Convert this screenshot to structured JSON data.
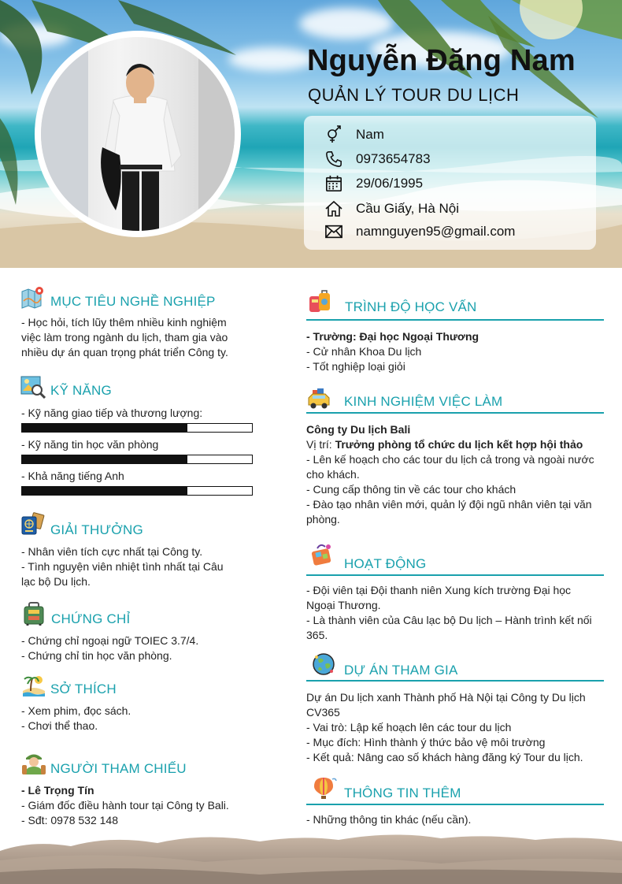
{
  "profile": {
    "name": "Nguyễn Đăng Nam",
    "job_title": "QUẢN LÝ TOUR DU LỊCH",
    "gender": "Nam",
    "phone": "0973654783",
    "birthday": "29/06/1995",
    "address": "Cầu Giấy, Hà Nội",
    "email": "namnguyen95@gmail.com"
  },
  "objective": {
    "title": "MỤC TIÊU NGHỀ NGHIỆP",
    "lines": [
      "- Học hỏi, tích lũy thêm nhiều kinh nghiệm",
      "việc làm trong ngành du lịch, tham gia vào",
      "nhiều dự án quan trọng phát triển Công ty."
    ]
  },
  "skills": {
    "title": "KỸ NĂNG",
    "items": [
      {
        "label": "- Kỹ năng giao tiếp và thương lượng:",
        "level": 0.72
      },
      {
        "label": "- Kỹ năng tin học văn phòng",
        "level": 0.72
      },
      {
        "label": "- Khả năng tiếng Anh",
        "level": 0.72
      }
    ]
  },
  "awards": {
    "title": "GIẢI THƯỞNG",
    "lines": [
      "- Nhân viên tích cực nhất tại Công ty.",
      "- Tình nguyện viên nhiệt tình nhất tại Câu",
      "lạc bộ Du lịch."
    ]
  },
  "certificates": {
    "title": "CHỨNG CHỈ",
    "lines": [
      "- Chứng chỉ ngoại ngữ TOIEC 3.7/4.",
      "- Chứng chỉ tin học văn phòng."
    ]
  },
  "hobbies": {
    "title": "SỞ THÍCH",
    "lines": [
      "- Xem phim, đọc sách.",
      "- Chơi thể thao."
    ]
  },
  "references": {
    "title": "NGƯỜI THAM CHIẾU",
    "name": "- Lê Trọng Tín",
    "lines": [
      "- Giám đốc điều hành tour tại Công ty Bali.",
      "- Sđt: 0978 532 148"
    ]
  },
  "education": {
    "title": "TRÌNH ĐỘ HỌC VẤN",
    "school_label": "- Trường: ",
    "school": "Đại học Ngoại Thương",
    "lines": [
      "- Cử nhân Khoa Du lịch",
      "- Tốt nghiệp loại giỏi"
    ]
  },
  "experience": {
    "title": "KINH NGHIỆM VIỆC LÀM",
    "company": "Công ty Du lịch Bali",
    "position_label": "Vị trí: ",
    "position": "Trưởng phòng tổ chức du lịch kết hợp hội thảo",
    "lines": [
      "- Lên kế hoạch cho các tour du lịch cả trong và ngoài nước",
      "cho khách.",
      "- Cung cấp thông tin về các tour cho khách",
      "- Đào tạo nhân viên mới, quản lý đội ngũ nhân viên tại văn",
      "phòng."
    ]
  },
  "activities": {
    "title": "HOẠT ĐỘNG",
    "lines": [
      "- Đội viên tại Đội thanh niên Xung kích trường Đại học",
      "Ngoại Thương.",
      "- Là thành viên của Câu lạc bộ Du lịch – Hành trình kết nối",
      "365."
    ]
  },
  "projects": {
    "title": "DỰ ÁN THAM GIA",
    "lines": [
      "Dự án Du lịch xanh Thành phố Hà Nội tại Công ty Du lịch",
      "CV365",
      "- Vai trò: Lập kế hoạch lên các tour du lịch",
      "- Mục đích: Hình thành ý thức bảo vệ môi trường",
      "- Kết quả: Nâng cao số khách hàng đăng ký Tour du lịch."
    ]
  },
  "extra": {
    "title": "THÔNG TIN THÊM",
    "lines": [
      "- Những thông tin khác (nếu cần)."
    ]
  },
  "colors": {
    "accent": "#1aa1ad",
    "text": "#222222",
    "bar": "#111111"
  }
}
